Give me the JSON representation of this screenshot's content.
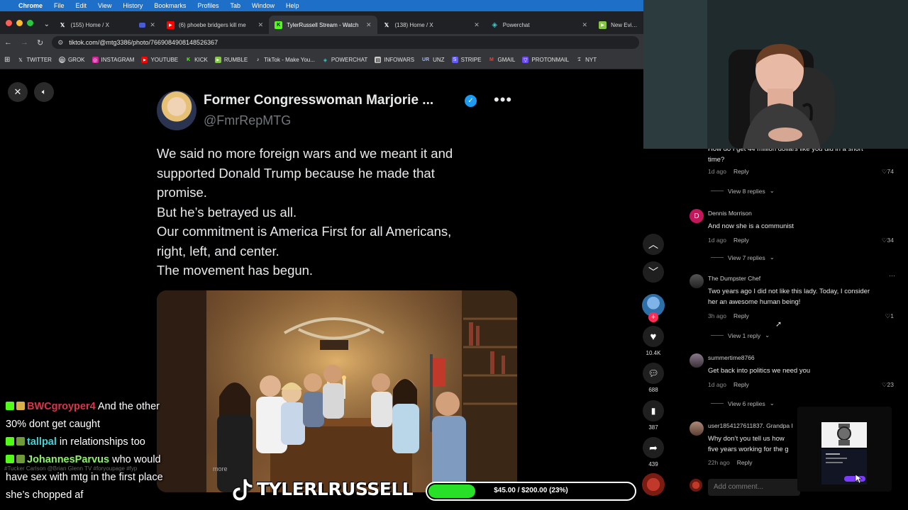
{
  "menubar": {
    "app": "Chrome",
    "items": [
      "File",
      "Edit",
      "View",
      "History",
      "Bookmarks",
      "Profiles",
      "Tab",
      "Window",
      "Help"
    ]
  },
  "tabs": [
    {
      "title": "(155) Home / X",
      "icon": "x-icon",
      "color": "#ffffff"
    },
    {
      "title": "(6) phoebe bridgers kill me",
      "icon": "youtube-icon",
      "color": "#ff0000"
    },
    {
      "title": "TylerRussell Stream - Watch",
      "icon": "kick-icon",
      "color": "#53fc18"
    },
    {
      "title": "(138) Home / X",
      "icon": "x-icon",
      "color": "#ffffff"
    },
    {
      "title": "Powerchat",
      "icon": "powerchat-icon",
      "color": "#41c8c8"
    },
    {
      "title": "New Evidence",
      "icon": "rumble-icon",
      "color": "#85c742"
    }
  ],
  "address": {
    "url": "tiktok.com/@mtg3386/photo/7669084908148526367"
  },
  "bookmarks": [
    {
      "label": "TWITTER",
      "icon": "x-icon",
      "color": "#000000"
    },
    {
      "label": "GROK",
      "icon": "grok-icon",
      "color": "#444444"
    },
    {
      "label": "INSTAGRAM",
      "icon": "instagram-icon",
      "color": "#d6249f"
    },
    {
      "label": "YOUTUBE",
      "icon": "youtube-icon",
      "color": "#ff0000"
    },
    {
      "label": "KICK",
      "icon": "kick-icon",
      "color": "#53fc18"
    },
    {
      "label": "RUMBLE",
      "icon": "rumble-icon",
      "color": "#85c742"
    },
    {
      "label": "TikTok - Make You...",
      "icon": "tiktok-icon",
      "color": "#111111"
    },
    {
      "label": "POWERCHAT",
      "icon": "powerchat-icon",
      "color": "#41c8c8"
    },
    {
      "label": "INFOWARS",
      "icon": "infowars-icon",
      "color": "#cccccc"
    },
    {
      "label": "UNZ",
      "icon": "unz-icon",
      "color": "#2255aa"
    },
    {
      "label": "STRIPE",
      "icon": "stripe-icon",
      "color": "#635bff"
    },
    {
      "label": "GMAIL",
      "icon": "gmail-icon",
      "color": "#ea4335"
    },
    {
      "label": "PROTONMAIL",
      "icon": "protonmail-icon",
      "color": "#6d4aff"
    },
    {
      "label": "NYT",
      "icon": "nyt-icon",
      "color": "#222222"
    }
  ],
  "tweet": {
    "name": "Former Congresswoman Marjorie ...",
    "handle": "@FmrRepMTG",
    "lines": [
      "We said no more foreign wars and we meant it and",
      "supported Donald Trump because he made that",
      "promise.",
      "But he’s betrayed us all.",
      "Our commitment is America First for all Americans,",
      "right, left, and center.",
      "The movement has begun."
    ]
  },
  "rail": {
    "likes": "10.4K",
    "comments": "688",
    "saves": "387",
    "shares": "439"
  },
  "chat": {
    "lines": [
      {
        "user": "BWCgroyper4",
        "text": " And the other"
      },
      {
        "user": "",
        "text": "30% dont get caught"
      },
      {
        "user": "tallpal",
        "text": " in relationships too"
      },
      {
        "user": "JohannesParvus",
        "text": " who would"
      },
      {
        "user": "",
        "text": "have sex with mtg in the first place"
      },
      {
        "user": "",
        "text": "she’s chopped af"
      }
    ]
  },
  "overlay": {
    "caption": "#Tucker Carlson @Brian Glenn TV #foryoupage #fyp",
    "more": "more",
    "streamer": "TYLERLRUSSELL",
    "goal_text": "$45.00 / $200.00 (23%)",
    "goal_fraction": 0.23
  },
  "comments": {
    "items": [
      {
        "text_lines": [
          "How do I get 44 million dollars like you did in a short",
          "time?"
        ],
        "time": "1d ago",
        "reply": "Reply",
        "likes": "74",
        "view": "View 8 replies"
      },
      {
        "user": "Dennis Morrison",
        "initial": "D",
        "text_lines": [
          "And now she is a communist"
        ],
        "time": "1d ago",
        "reply": "Reply",
        "likes": "34",
        "view": "View 7 replies"
      },
      {
        "user": "The Dumpster Chef",
        "text_lines": [
          "Two years ago I did not like this lady. Today, I consider",
          "her an awesome human being!"
        ],
        "time": "3h ago",
        "reply": "Reply",
        "likes": "1",
        "view": "View 1 reply"
      },
      {
        "user": "summertime8766",
        "text_lines": [
          "Get back into politics we need you"
        ],
        "time": "1d ago",
        "reply": "Reply",
        "likes": "23",
        "view": "View 6 replies"
      },
      {
        "user": "user1854127611837. Grandpa I",
        "text_lines": [
          "Why don’t you tell us how",
          "five years working for the g"
        ],
        "time": "22h ago",
        "reply": "Reply"
      }
    ],
    "add_placeholder": "Add comment..."
  }
}
